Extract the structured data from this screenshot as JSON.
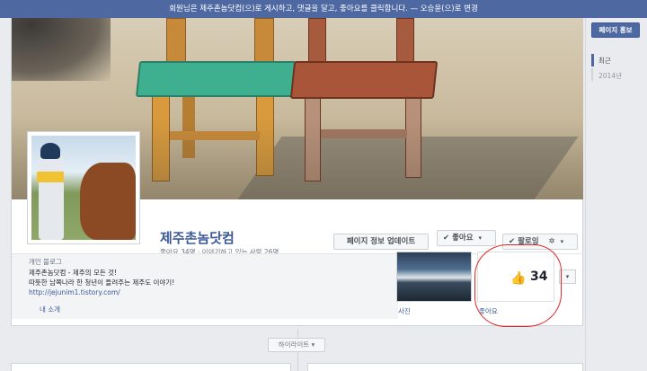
{
  "top_notice": "회원님은 제주촌놈닷컴(으)로 게시하고, 댓글을 달고, 좋아요를 클릭합니다. — 오승윤(으)로 변경",
  "page": {
    "name": "제주촌놈닷컴",
    "stats": "좋아요 34명 · 이야기하고 있는 사람 26명"
  },
  "buttons": {
    "update_info": "페이지 정보 업데이트",
    "like": "좋아요",
    "follow": "팔로잉",
    "more_caret": "▾",
    "gear": "✲"
  },
  "about": {
    "category": "개인 블로그",
    "line1": "제주촌놈닷컴 - 제주의 모든 것!",
    "line2": "따뜻한 남쪽나라 한 청년이 들려주는 제주도 이야기!",
    "link": "http://jejunim1.tistory.com/",
    "tab": "내 소개"
  },
  "apps": {
    "photos_label": "사진",
    "likes_label": "좋아요",
    "likes_count": "34"
  },
  "timeline": {
    "highlight_button": "하이라이트 ▾"
  },
  "right_rail": {
    "promo_button": "페이지 홍보",
    "recent": "최근",
    "year": "2014년"
  },
  "colors": {
    "brand": "#4e69a2",
    "link": "#3b5998",
    "annotation": "#e02828"
  }
}
